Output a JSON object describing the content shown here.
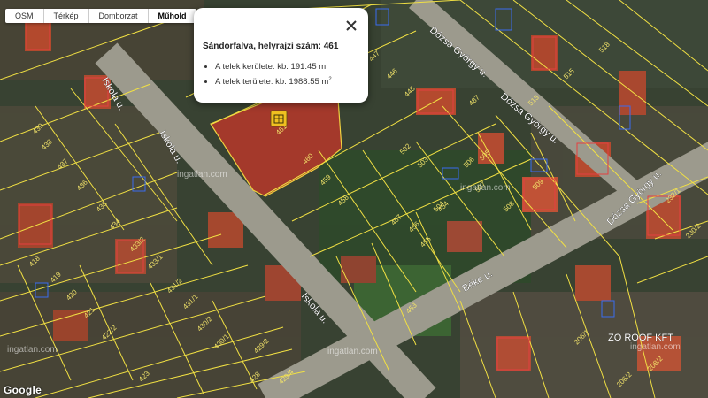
{
  "layer_tabs": [
    {
      "label": "OSM",
      "active": false
    },
    {
      "label": "Térkép",
      "active": false
    },
    {
      "label": "Domborzat",
      "active": false
    },
    {
      "label": "Műhold",
      "active": true
    }
  ],
  "popup": {
    "title": "Sándorfalva, helyrajzi szám: 461",
    "perimeter": "A telek kerülete: kb. 191.45 m",
    "area_text": "A telek területe: kb. 1988.55 m",
    "area_unit_sup": "2"
  },
  "map": {
    "streets": {
      "iskola_1": "Iskola u.",
      "iskola_2": "Iskola u.",
      "iskola_3": "Iskola u.",
      "dozsa_1": "Dózsa György u.",
      "dozsa_2": "Dózsa György u.",
      "dozsa_3": "Dózsa György u.",
      "beke": "Béke u."
    },
    "parcels": [
      {
        "id": "p461",
        "label": "461"
      },
      {
        "id": "p460",
        "label": "460"
      },
      {
        "id": "p459",
        "label": "459"
      },
      {
        "id": "p458",
        "label": "458"
      },
      {
        "id": "p457",
        "label": "457"
      },
      {
        "id": "p455",
        "label": "455"
      },
      {
        "id": "p453",
        "label": "453"
      },
      {
        "id": "p454",
        "label": "454"
      },
      {
        "id": "p456",
        "label": "456"
      },
      {
        "id": "p502",
        "label": "502"
      },
      {
        "id": "p503",
        "label": "503"
      },
      {
        "id": "p504",
        "label": "504"
      },
      {
        "id": "p505",
        "label": "505"
      },
      {
        "id": "p506",
        "label": "506"
      },
      {
        "id": "p507",
        "label": "507"
      },
      {
        "id": "p508",
        "label": "508"
      },
      {
        "id": "p509",
        "label": "509"
      },
      {
        "id": "p439",
        "label": "439"
      },
      {
        "id": "p438",
        "label": "438"
      },
      {
        "id": "p437",
        "label": "437"
      },
      {
        "id": "p436",
        "label": "436"
      },
      {
        "id": "p435",
        "label": "435"
      },
      {
        "id": "p434",
        "label": "434"
      },
      {
        "id": "p4332",
        "label": "433/2"
      },
      {
        "id": "p4331",
        "label": "433/1"
      },
      {
        "id": "p4312",
        "label": "431/2"
      },
      {
        "id": "p4311",
        "label": "431/1"
      },
      {
        "id": "p4302",
        "label": "430/2"
      },
      {
        "id": "p4301",
        "label": "430/1"
      },
      {
        "id": "p4292",
        "label": "429/2"
      },
      {
        "id": "p4294",
        "label": "429/4"
      },
      {
        "id": "p428",
        "label": "428"
      },
      {
        "id": "p4222",
        "label": "422/2"
      },
      {
        "id": "p423",
        "label": "423"
      },
      {
        "id": "p418",
        "label": "418"
      },
      {
        "id": "p419",
        "label": "419"
      },
      {
        "id": "p420",
        "label": "420"
      },
      {
        "id": "p421",
        "label": "421"
      },
      {
        "id": "p2321",
        "label": "232/1"
      },
      {
        "id": "p2302",
        "label": "230/2"
      },
      {
        "id": "p2061",
        "label": "206/1"
      },
      {
        "id": "p2062",
        "label": "206/2"
      },
      {
        "id": "p2082",
        "label": "208/2"
      },
      {
        "id": "p487",
        "label": "487"
      },
      {
        "id": "p518",
        "label": "518"
      },
      {
        "id": "p515",
        "label": "515"
      },
      {
        "id": "p513",
        "label": "513"
      },
      {
        "id": "p447",
        "label": "447"
      },
      {
        "id": "p446",
        "label": "446"
      },
      {
        "id": "p445",
        "label": "445"
      }
    ],
    "watermarks": [
      "ingatlan.com",
      "ingatlan.com",
      "ingatlan.com",
      "ingatlan.com",
      "ingatlan.com"
    ],
    "company_sign": "ZO ROOF KFT"
  },
  "attribution": "Google",
  "icons": {
    "close": "close-icon",
    "parcel_marker": "building-marker-icon"
  }
}
